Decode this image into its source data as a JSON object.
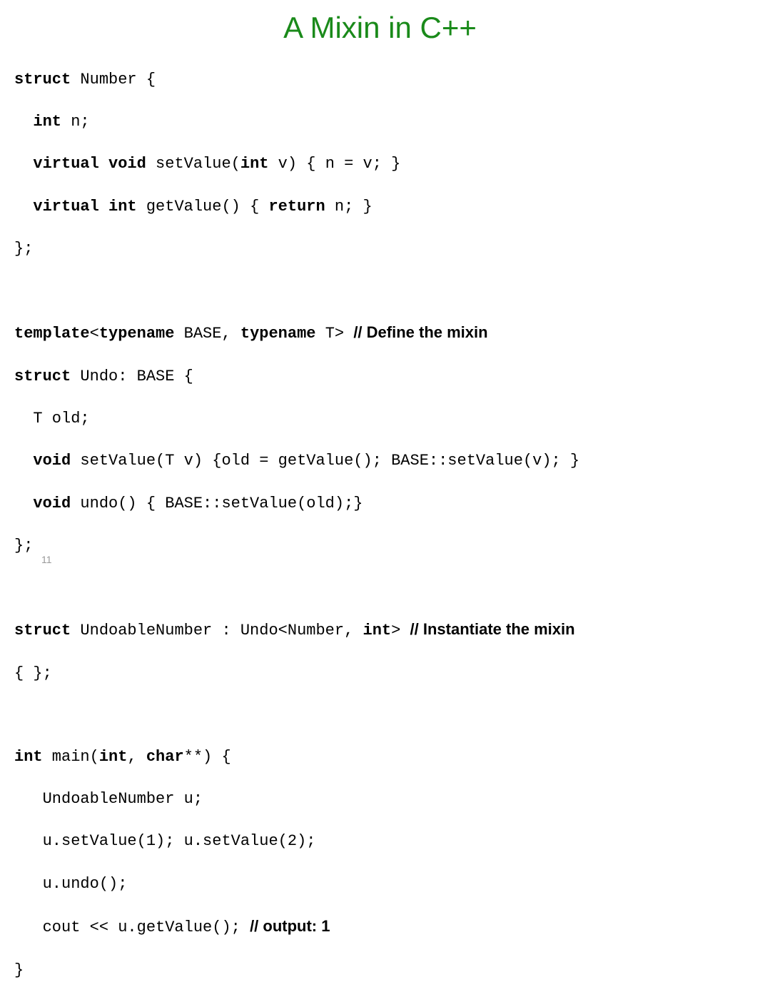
{
  "title": "A Mixin in C++",
  "page_number": "11",
  "code": {
    "l1_kw1": "struct",
    "l1_rest": " Number {",
    "l2_indent": "  ",
    "l2_kw1": "int",
    "l2_rest": " n;",
    "l3_indent": "  ",
    "l3_kw1": "virtual void",
    "l3_mid": " setValue(",
    "l3_kw2": "int",
    "l3_rest": " v) { n = v; }",
    "l4_indent": "  ",
    "l4_kw1": "virtual int",
    "l4_mid": " getValue() { ",
    "l4_kw2": "return",
    "l4_rest": " n; }",
    "l5": "};",
    "l6_kw1": "template",
    "l6_mid1": "<",
    "l6_kw2": "typename",
    "l6_mid2": " BASE, ",
    "l6_kw3": "typename",
    "l6_mid3": " T> ",
    "l6_comment": "// Define the mixin",
    "l7_kw1": "struct",
    "l7_rest": " Undo: BASE {",
    "l8": "  T old;",
    "l9_indent": "  ",
    "l9_kw1": "void",
    "l9_rest": " setValue(T v) {old = getValue(); BASE::setValue(v); }",
    "l10_indent": "  ",
    "l10_kw1": "void",
    "l10_rest": " undo() { BASE::setValue(old);}",
    "l11": "};",
    "l12_kw1": "struct",
    "l12_mid": " UndoableNumber : Undo<Number, ",
    "l12_kw2": "int",
    "l12_mid2": "> ",
    "l12_comment": "// Instantiate the mixin",
    "l13": "{ };",
    "l14_kw1": "int",
    "l14_mid1": " main(",
    "l14_kw2": "int",
    "l14_mid2": ", ",
    "l14_kw3": "char",
    "l14_rest": "**) {",
    "l15": "   UndoableNumber u;",
    "l16": "   u.setValue(1); u.setValue(2);",
    "l17": "   u.undo();",
    "l18_mid": "   cout << u.getValue(); ",
    "l18_comment": "// output: 1",
    "l19": "}"
  }
}
